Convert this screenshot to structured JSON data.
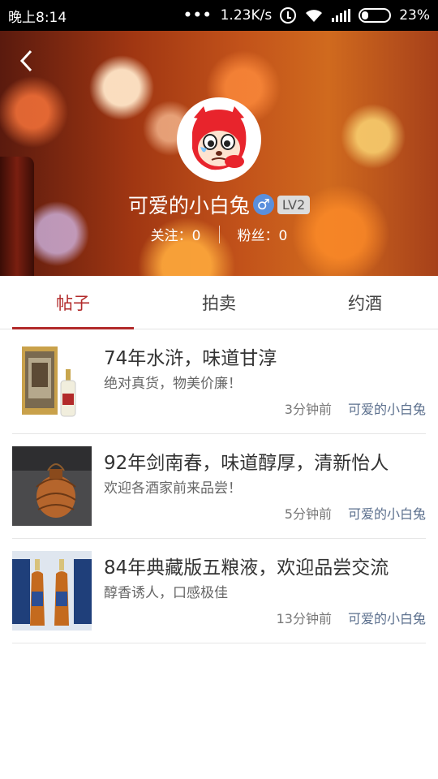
{
  "status_bar": {
    "time": "晚上8:14",
    "dots": "•••",
    "network_speed": "1.23K/s",
    "battery": "23%",
    "battery_level": 0.23
  },
  "profile": {
    "username": "可爱的小白兔",
    "gender_symbol": "♂",
    "level": "LV2",
    "following_text": "关注：0",
    "followers_text": "粉丝：0"
  },
  "tabs": [
    {
      "label": "帖子",
      "active": true
    },
    {
      "label": "拍卖",
      "active": false
    },
    {
      "label": "约酒",
      "active": false
    }
  ],
  "posts": [
    {
      "title": "74年水浒，味道甘淳",
      "desc": "绝对真货，物美价廉！",
      "time": "3分钟前",
      "author": "可爱的小白兔"
    },
    {
      "title": "92年剑南春，味道醇厚，清新怡人",
      "desc": "欢迎各酒家前来品尝！",
      "time": "5分钟前",
      "author": "可爱的小白兔"
    },
    {
      "title": "84年典藏版五粮液，欢迎品尝交流",
      "desc": "醇香诱人，口感极佳",
      "time": "13分钟前",
      "author": "可爱的小白兔"
    }
  ],
  "colors": {
    "accent": "#b22a2a",
    "author_link": "#5b6f8d",
    "gender_badge": "#5a8fdc"
  },
  "icons": {
    "back": "back-arrow-icon",
    "gender": "male-icon",
    "alarm": "alarm-icon",
    "wifi": "wifi-icon",
    "signal": "signal-icon",
    "battery": "battery-icon"
  }
}
